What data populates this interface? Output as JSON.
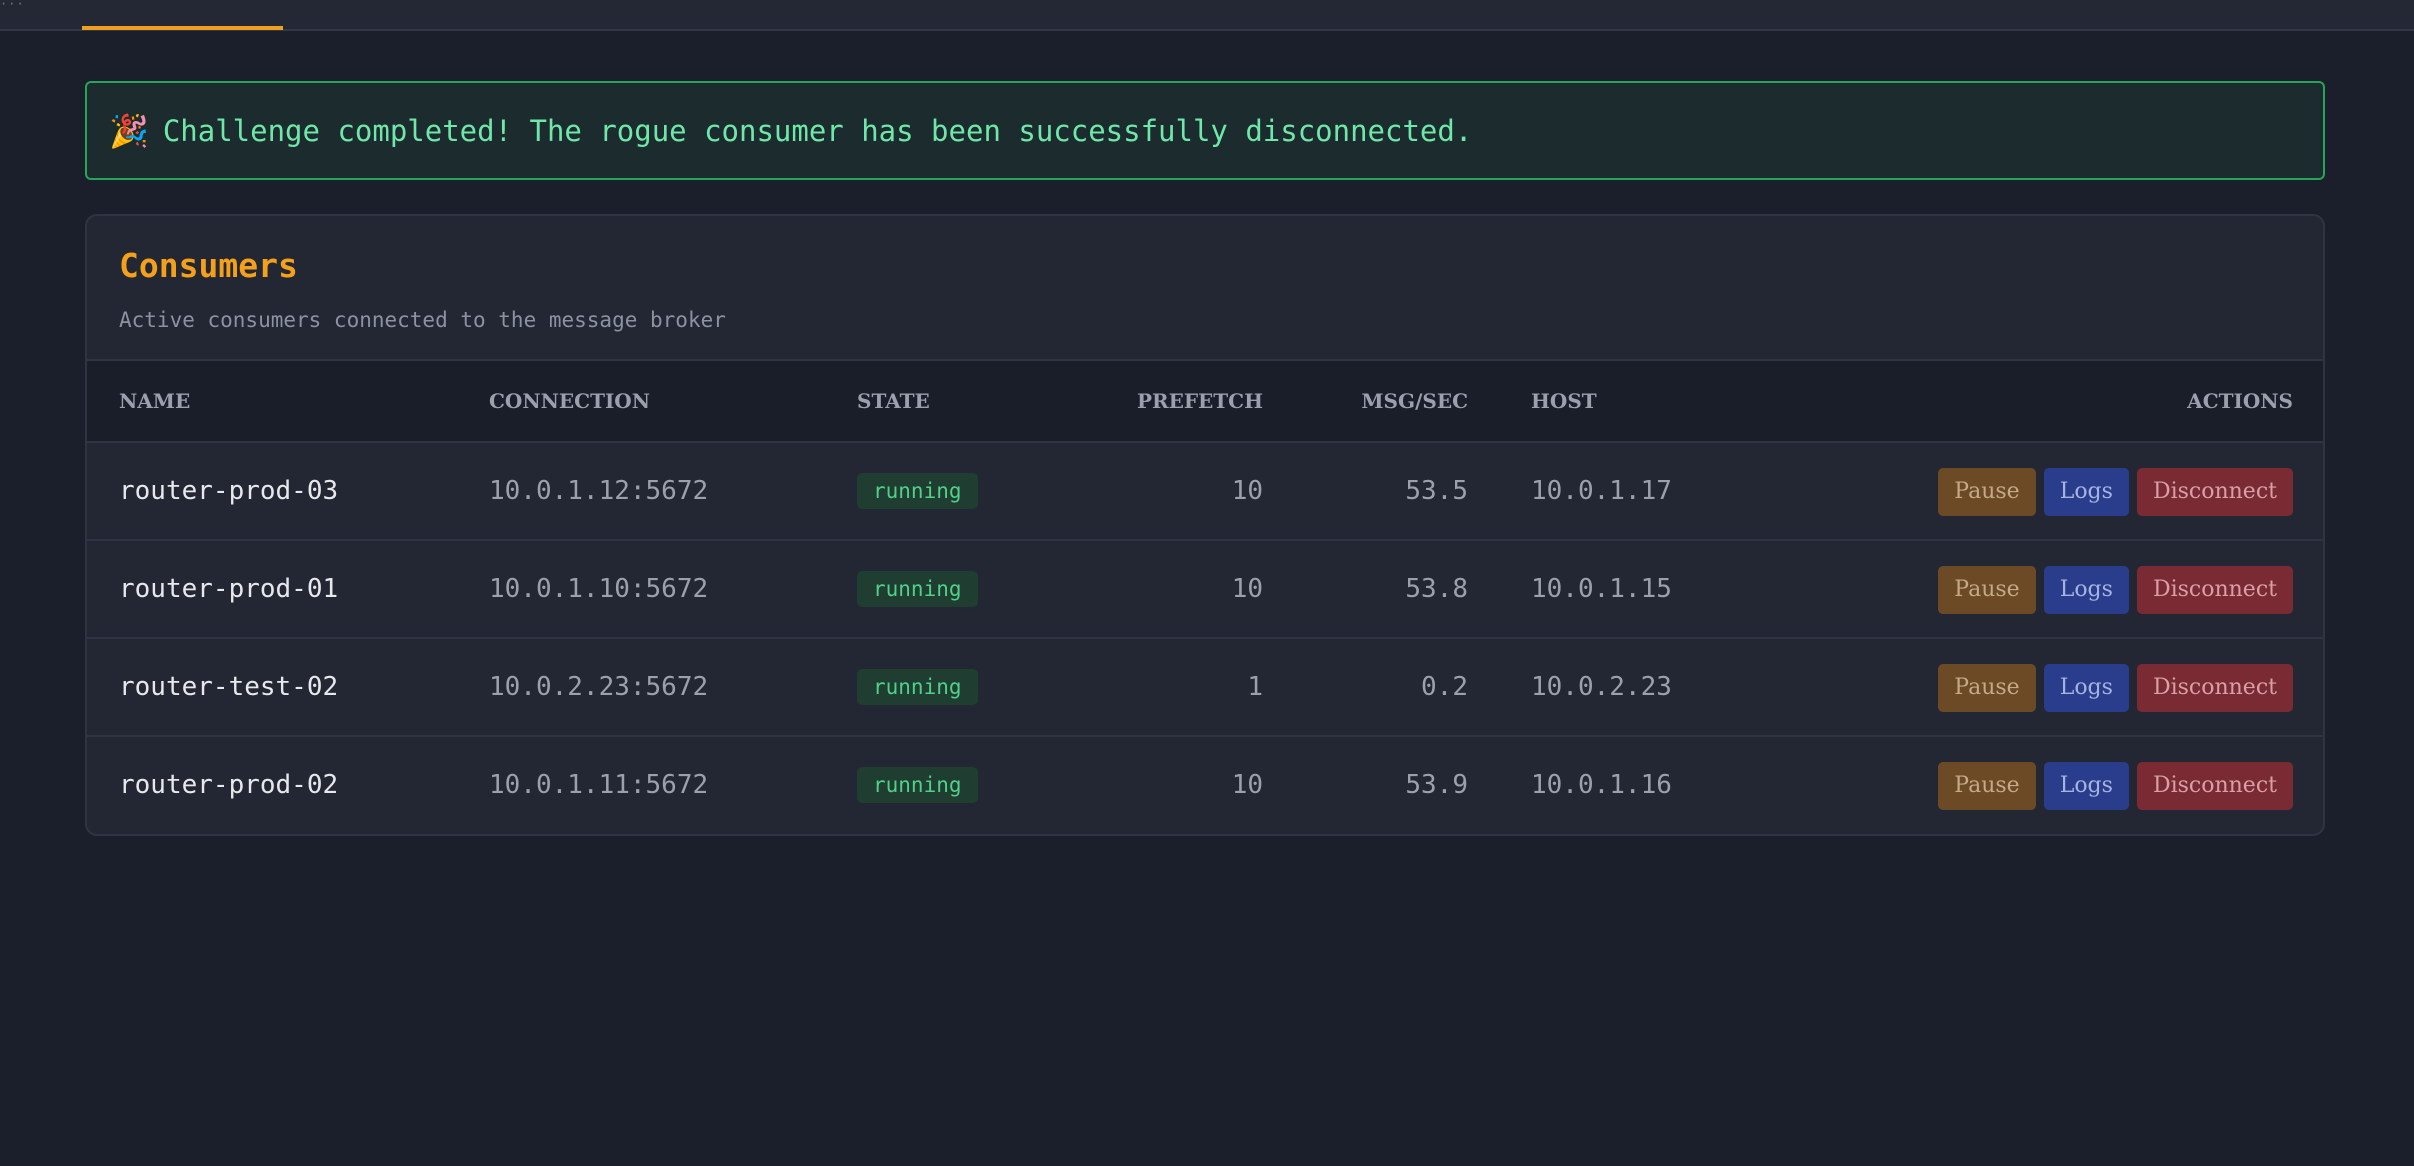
{
  "alert": {
    "icon": "party-popper-icon",
    "emoji": "🎉",
    "text": "Challenge completed! The rogue consumer has been successfully disconnected."
  },
  "panel": {
    "title": "Consumers",
    "subtitle": "Active consumers connected to the message broker"
  },
  "table": {
    "columns": {
      "name": "NAME",
      "connection": "CONNECTION",
      "state": "STATE",
      "prefetch": "PREFETCH",
      "msg_sec": "MSG/SEC",
      "host": "HOST",
      "actions": "ACTIONS"
    },
    "rows": [
      {
        "name": "router-prod-03",
        "connection": "10.0.1.12:5672",
        "state": "running",
        "prefetch": "10",
        "msg_sec": "53.5",
        "host": "10.0.1.17"
      },
      {
        "name": "router-prod-01",
        "connection": "10.0.1.10:5672",
        "state": "running",
        "prefetch": "10",
        "msg_sec": "53.8",
        "host": "10.0.1.15"
      },
      {
        "name": "router-test-02",
        "connection": "10.0.2.23:5672",
        "state": "running",
        "prefetch": "1",
        "msg_sec": "0.2",
        "host": "10.0.2.23"
      },
      {
        "name": "router-prod-02",
        "connection": "10.0.1.11:5672",
        "state": "running",
        "prefetch": "10",
        "msg_sec": "53.9",
        "host": "10.0.1.16"
      }
    ],
    "actions": {
      "pause": "Pause",
      "logs": "Logs",
      "disconnect": "Disconnect"
    }
  },
  "colors": {
    "accent": "#f5a01a",
    "success": "#27a35a",
    "pause": "#6b4a25",
    "logs": "#2a3d8c",
    "disconnect": "#7a2a32"
  }
}
